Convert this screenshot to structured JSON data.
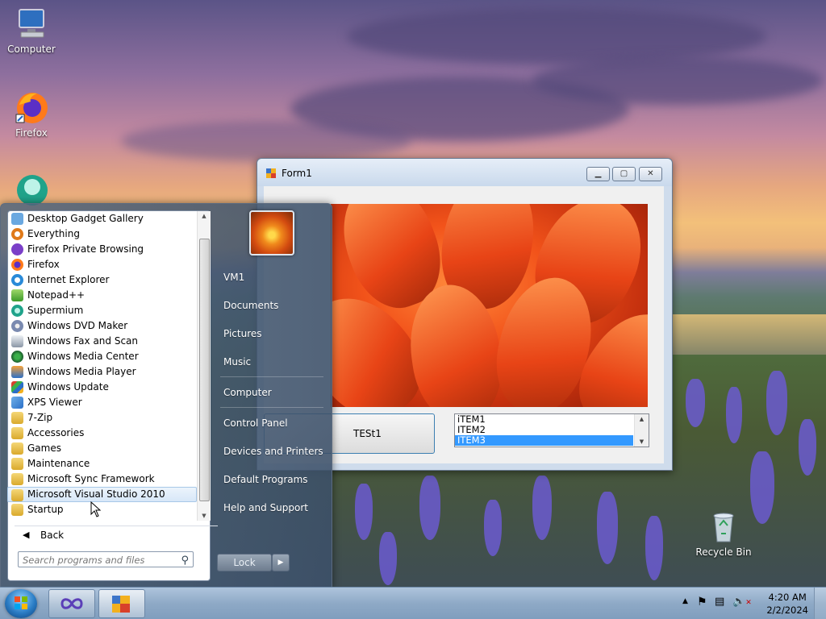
{
  "desktop": {
    "icons": [
      {
        "label": "Computer",
        "icon": "computer-icon"
      },
      {
        "label": "Firefox",
        "icon": "firefox-icon"
      },
      {
        "label": "Recycle Bin",
        "icon": "recycle-bin-icon"
      }
    ]
  },
  "form1": {
    "title": "Form1",
    "button_label": "TESt1",
    "listbox": {
      "items": [
        "iTEM1",
        "ITEM2",
        "ITEM3"
      ],
      "selected_index": 2
    }
  },
  "start_menu": {
    "programs": [
      {
        "label": "Desktop Gadget Gallery",
        "icon": "gadget-icon"
      },
      {
        "label": "Everything",
        "icon": "magnifier-icon"
      },
      {
        "label": "Firefox Private Browsing",
        "icon": "firefox-private-icon"
      },
      {
        "label": "Firefox",
        "icon": "firefox-icon"
      },
      {
        "label": "Internet Explorer",
        "icon": "ie-icon"
      },
      {
        "label": "Notepad++",
        "icon": "notepadpp-icon"
      },
      {
        "label": "Supermium",
        "icon": "supermium-icon"
      },
      {
        "label": "Windows DVD Maker",
        "icon": "dvd-maker-icon"
      },
      {
        "label": "Windows Fax and Scan",
        "icon": "fax-icon"
      },
      {
        "label": "Windows Media Center",
        "icon": "media-center-icon"
      },
      {
        "label": "Windows Media Player",
        "icon": "media-player-icon"
      },
      {
        "label": "Windows Update",
        "icon": "windows-update-icon"
      },
      {
        "label": "XPS Viewer",
        "icon": "xps-icon"
      },
      {
        "label": "7-Zip",
        "icon": "folder-icon"
      },
      {
        "label": "Accessories",
        "icon": "folder-icon"
      },
      {
        "label": "Games",
        "icon": "folder-icon"
      },
      {
        "label": "Maintenance",
        "icon": "folder-icon"
      },
      {
        "label": "Microsoft Sync Framework",
        "icon": "folder-icon"
      },
      {
        "label": "Microsoft Visual Studio 2010",
        "icon": "folder-icon"
      },
      {
        "label": "Startup",
        "icon": "folder-icon"
      }
    ],
    "highlighted_index": 18,
    "back_label": "Back",
    "search_placeholder": "Search programs and files",
    "right_items": [
      "VM1",
      "Documents",
      "Pictures",
      "Music",
      "Computer",
      "Control Panel",
      "Devices and Printers",
      "Default Programs",
      "Help and Support"
    ],
    "lock_label": "Lock"
  },
  "taskbar": {
    "time": "4:20 AM",
    "date": "2/2/2024"
  }
}
